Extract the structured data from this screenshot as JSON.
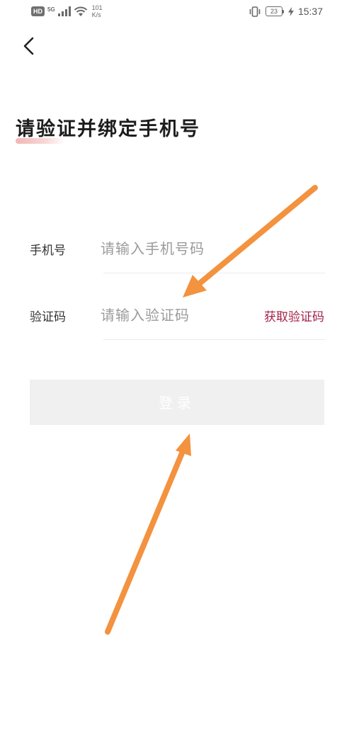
{
  "status_bar": {
    "hd": "HD",
    "network": "5G",
    "speed_value": "101",
    "speed_unit": "K/s",
    "battery": "23",
    "time": "15:37"
  },
  "icons": {
    "back": "chevron-left-icon",
    "signal": "cellular-signal-icon",
    "wifi": "wifi-icon",
    "vibrate": "vibrate-icon",
    "charging": "bolt-icon"
  },
  "page": {
    "title": "请验证并绑定手机号"
  },
  "form": {
    "phone": {
      "label": "手机号",
      "placeholder": "请输入手机号码",
      "value": ""
    },
    "code": {
      "label": "验证码",
      "placeholder": "请输入验证码",
      "value": "",
      "get_code_label": "获取验证码"
    },
    "login_label": "登录"
  },
  "colors": {
    "accent": "#a3224a",
    "title_underline": "#f2b5b5",
    "button_disabled": "#f0f0f0",
    "annotation_arrow": "#f3923f"
  }
}
